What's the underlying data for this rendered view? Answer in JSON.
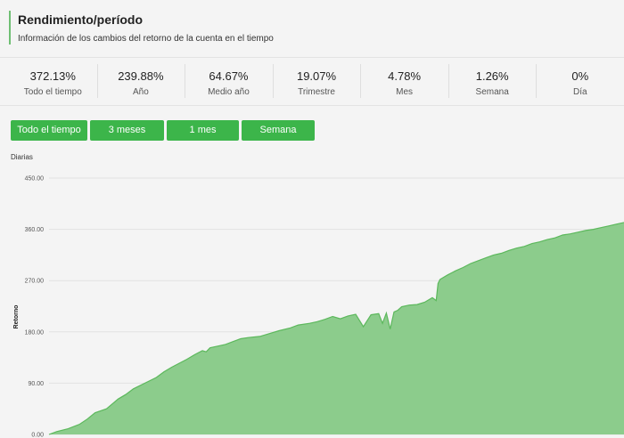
{
  "header": {
    "title": "Rendimiento/período",
    "subtitle": "Información de los cambios del retorno de la cuenta en el tiempo"
  },
  "stats": [
    {
      "value": "372.13%",
      "label": "Todo el tiempo"
    },
    {
      "value": "239.88%",
      "label": "Año"
    },
    {
      "value": "64.67%",
      "label": "Medio año"
    },
    {
      "value": "19.07%",
      "label": "Trimestre"
    },
    {
      "value": "4.78%",
      "label": "Mes"
    },
    {
      "value": "1.26%",
      "label": "Semana"
    },
    {
      "value": "0%",
      "label": "Día"
    }
  ],
  "buttons": {
    "all": "Todo el tiempo",
    "three_months": "3 meses",
    "one_month": "1 mes",
    "week": "Semana"
  },
  "chart_data": {
    "type": "area",
    "title": "Diarias",
    "xlabel": "",
    "ylabel": "Retorno",
    "ylim": [
      0,
      450
    ],
    "yticks": [
      "0.00",
      "90.00",
      "180.00",
      "270.00",
      "360.00",
      "450.00"
    ],
    "grid": true,
    "color": "#8ccc8c",
    "line_color": "#5cb85c",
    "x": [
      0,
      2,
      5,
      8,
      10,
      12,
      15,
      18,
      20,
      22,
      25,
      28,
      30,
      32,
      34,
      36,
      38,
      40,
      41,
      42,
      44,
      46,
      48,
      50,
      52,
      55,
      58,
      60,
      63,
      65,
      68,
      70,
      72,
      74,
      76,
      78,
      80,
      82,
      84,
      86,
      87,
      88,
      89,
      90,
      91,
      92,
      94,
      96,
      98,
      100,
      101,
      101.5,
      102,
      104,
      106,
      108,
      110,
      112,
      114,
      116,
      118,
      120,
      122,
      124,
      126,
      128,
      130,
      132,
      134,
      136,
      138,
      140,
      142,
      144,
      146,
      148,
      150
    ],
    "y": [
      0,
      5,
      10,
      18,
      27,
      38,
      45,
      62,
      70,
      80,
      90,
      100,
      110,
      118,
      125,
      132,
      140,
      147,
      145,
      152,
      155,
      158,
      163,
      168,
      170,
      172,
      178,
      182,
      187,
      192,
      195,
      198,
      202,
      207,
      203,
      208,
      211,
      189,
      210,
      212,
      195,
      213,
      185,
      215,
      218,
      224,
      227,
      228,
      232,
      240,
      235,
      265,
      272,
      280,
      287,
      293,
      300,
      305,
      310,
      315,
      318,
      323,
      327,
      330,
      335,
      338,
      342,
      345,
      350,
      352,
      355,
      358,
      360,
      363,
      366,
      369,
      372
    ]
  }
}
